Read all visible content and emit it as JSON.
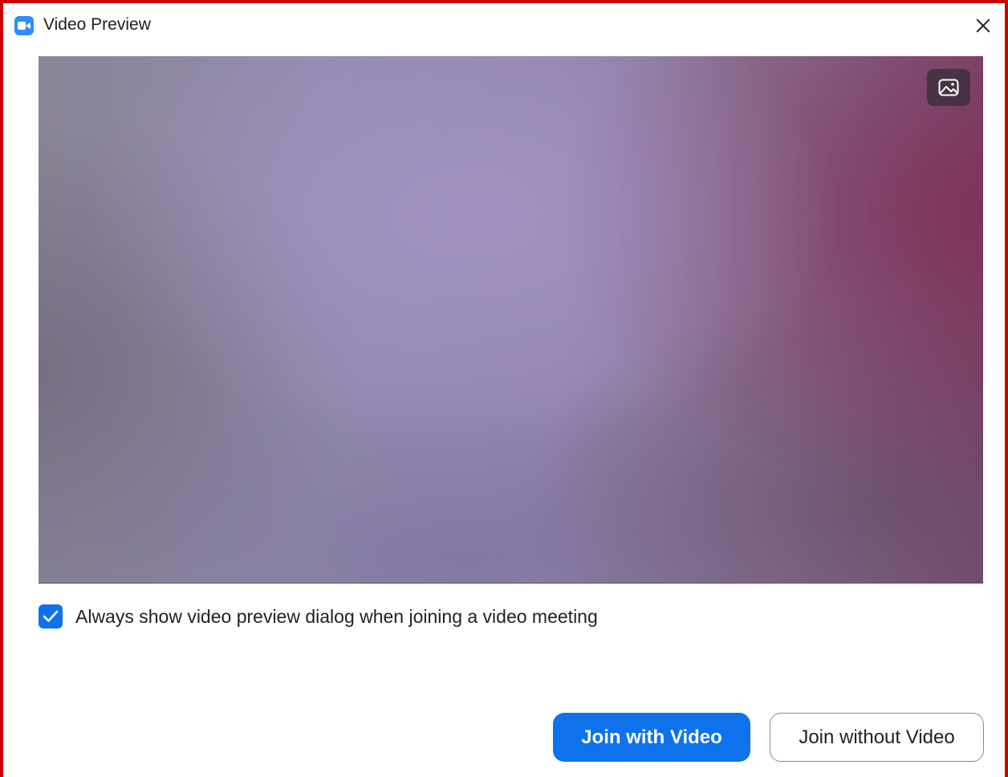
{
  "window": {
    "title": "Video Preview",
    "app_icon": "zoom-camera-icon",
    "close_icon": "close-icon"
  },
  "preview": {
    "background_icon": "image-background-icon"
  },
  "options": {
    "always_show_checked": true,
    "always_show_label": "Always show video preview dialog when joining a video meeting"
  },
  "actions": {
    "join_with_video": "Join with Video",
    "join_without_video": "Join without Video"
  },
  "colors": {
    "accent": "#0e72ed",
    "frame_border": "#cc0000"
  }
}
